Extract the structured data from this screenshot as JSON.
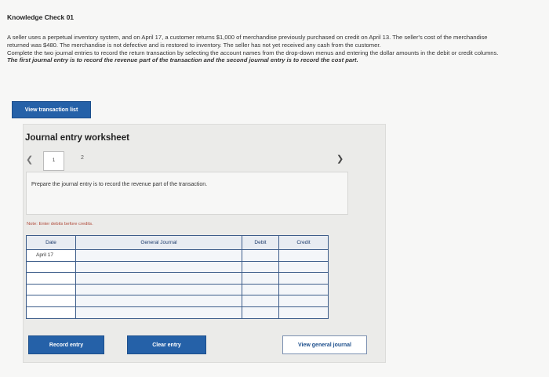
{
  "header": {
    "title": "Knowledge Check 01"
  },
  "problem": {
    "paragraph1": "A seller uses a perpetual inventory system, and on April 17, a customer returns $1,000 of merchandise previously purchased on credit on April 13. The seller's cost of the merchandise returned was $480. The merchandise is not defective and is restored to inventory. The seller has not yet received any cash from the customer.",
    "paragraph2": "Complete the two journal entries to record the return transaction by selecting the account names from the drop-down menus and entering the dollar amounts in the debit or credit columns.",
    "paragraph2_emphasis": "The first journal entry is to record the revenue part of the transaction and the second journal entry is to record the cost part."
  },
  "buttons": {
    "view_transaction": "View transaction list",
    "record_entry": "Record entry",
    "clear_entry": "Clear entry",
    "view_general_journal": "View general journal"
  },
  "worksheet": {
    "title": "Journal entry worksheet",
    "tabs": [
      "1",
      "2"
    ],
    "instruction": "Prepare the journal entry is to record the revenue part of the transaction.",
    "note": "Note: Enter debits before credits.",
    "columns": [
      "Date",
      "General Journal",
      "Debit",
      "Credit"
    ],
    "rows": [
      {
        "date": "April 17"
      },
      {
        "date": ""
      },
      {
        "date": ""
      },
      {
        "date": ""
      },
      {
        "date": ""
      },
      {
        "date": ""
      }
    ]
  }
}
